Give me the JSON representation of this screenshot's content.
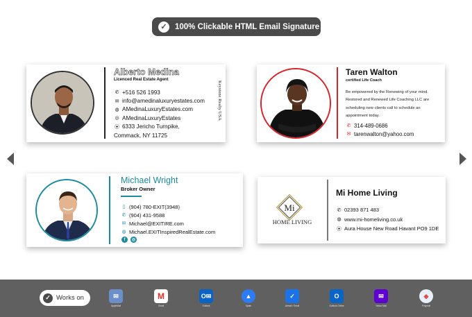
{
  "badge": {
    "icon": "check-circle-icon",
    "text": "100% Clickable HTML Email Signature"
  },
  "nav": {
    "prev_icon": "triangle-left-icon",
    "next_icon": "triangle-right-icon"
  },
  "cards": {
    "alberto": {
      "name": "Alberto Medina",
      "title": "Licenced Real Estate Agent",
      "phone": "+516 526 1993",
      "email": "info@amedinaluxuryestates.com",
      "website": "AMedinaLuxuryEstates.com",
      "social": "AMedinaLuxuryEstates",
      "address_line1": "6333 Jericho Turnpike,",
      "address_line2": "Commack, NY 11725",
      "brand_vertical": "Keystone Realty USA"
    },
    "taren": {
      "name": "Taren Walton",
      "title": "certified Life Coach",
      "bio": "Be empowered by the Renewing of your mind. Restored and Renewed Life Coaching LLC are scheduling new clients call to schedule an appointment today.",
      "phone": "314-489-0686",
      "email": "tarenwalton@yahoo.com",
      "accent": "#d8232a"
    },
    "michael": {
      "name": "Michael Wright",
      "title": "Broker Owner",
      "mobile": "(904) 780-EXIT(3948)",
      "phone": "(904) 431-9588",
      "email": "Michael@EXITIRE.com",
      "website": "Michael.EXITInspiredRealEstate.com",
      "social_1": "f",
      "accent": "#1b8ba0"
    },
    "mihome": {
      "name": "Mi Home Living",
      "logo_monogram": "Mi",
      "logo_text": "HOME LIVING",
      "phone": "02393 871 483",
      "website": "www.mi-homeliving.co.uk",
      "address": "Aura House New Road Havant PO9 1DE"
    }
  },
  "works_on": {
    "label": "Works on",
    "clients": [
      {
        "label": "AppleMail",
        "icon": "apple-mail-icon",
        "color": "#6b8fc9"
      },
      {
        "label": "Gmail",
        "icon": "gmail-icon",
        "color": "#ffffff"
      },
      {
        "label": "Outlook",
        "icon": "outlook-icon",
        "color": "#0a64c8"
      },
      {
        "label": "Spark",
        "icon": "spark-icon",
        "color": "#2d7cf6"
      },
      {
        "label": "Airmail / Email",
        "icon": "airmail-icon",
        "color": "#1a73e8"
      },
      {
        "label": "Outlook Online",
        "icon": "outlook-online-icon",
        "color": "#0a64c8"
      },
      {
        "label": "Yahoo Mail",
        "icon": "yahoo-mail-icon",
        "color": "#5f01d1"
      },
      {
        "label": "Polymail",
        "icon": "polymail-icon",
        "color": "#e7f0fa"
      }
    ]
  }
}
